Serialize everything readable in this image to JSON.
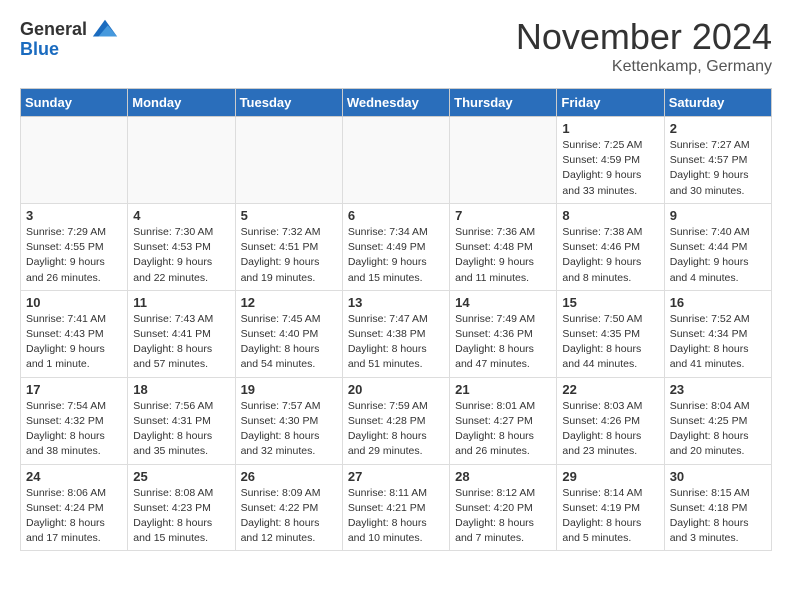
{
  "header": {
    "logo_general": "General",
    "logo_blue": "Blue",
    "month_title": "November 2024",
    "location": "Kettenkamp, Germany"
  },
  "days_of_week": [
    "Sunday",
    "Monday",
    "Tuesday",
    "Wednesday",
    "Thursday",
    "Friday",
    "Saturday"
  ],
  "weeks": [
    [
      {
        "day": "",
        "info": ""
      },
      {
        "day": "",
        "info": ""
      },
      {
        "day": "",
        "info": ""
      },
      {
        "day": "",
        "info": ""
      },
      {
        "day": "",
        "info": ""
      },
      {
        "day": "1",
        "info": "Sunrise: 7:25 AM\nSunset: 4:59 PM\nDaylight: 9 hours and 33 minutes."
      },
      {
        "day": "2",
        "info": "Sunrise: 7:27 AM\nSunset: 4:57 PM\nDaylight: 9 hours and 30 minutes."
      }
    ],
    [
      {
        "day": "3",
        "info": "Sunrise: 7:29 AM\nSunset: 4:55 PM\nDaylight: 9 hours and 26 minutes."
      },
      {
        "day": "4",
        "info": "Sunrise: 7:30 AM\nSunset: 4:53 PM\nDaylight: 9 hours and 22 minutes."
      },
      {
        "day": "5",
        "info": "Sunrise: 7:32 AM\nSunset: 4:51 PM\nDaylight: 9 hours and 19 minutes."
      },
      {
        "day": "6",
        "info": "Sunrise: 7:34 AM\nSunset: 4:49 PM\nDaylight: 9 hours and 15 minutes."
      },
      {
        "day": "7",
        "info": "Sunrise: 7:36 AM\nSunset: 4:48 PM\nDaylight: 9 hours and 11 minutes."
      },
      {
        "day": "8",
        "info": "Sunrise: 7:38 AM\nSunset: 4:46 PM\nDaylight: 9 hours and 8 minutes."
      },
      {
        "day": "9",
        "info": "Sunrise: 7:40 AM\nSunset: 4:44 PM\nDaylight: 9 hours and 4 minutes."
      }
    ],
    [
      {
        "day": "10",
        "info": "Sunrise: 7:41 AM\nSunset: 4:43 PM\nDaylight: 9 hours and 1 minute."
      },
      {
        "day": "11",
        "info": "Sunrise: 7:43 AM\nSunset: 4:41 PM\nDaylight: 8 hours and 57 minutes."
      },
      {
        "day": "12",
        "info": "Sunrise: 7:45 AM\nSunset: 4:40 PM\nDaylight: 8 hours and 54 minutes."
      },
      {
        "day": "13",
        "info": "Sunrise: 7:47 AM\nSunset: 4:38 PM\nDaylight: 8 hours and 51 minutes."
      },
      {
        "day": "14",
        "info": "Sunrise: 7:49 AM\nSunset: 4:36 PM\nDaylight: 8 hours and 47 minutes."
      },
      {
        "day": "15",
        "info": "Sunrise: 7:50 AM\nSunset: 4:35 PM\nDaylight: 8 hours and 44 minutes."
      },
      {
        "day": "16",
        "info": "Sunrise: 7:52 AM\nSunset: 4:34 PM\nDaylight: 8 hours and 41 minutes."
      }
    ],
    [
      {
        "day": "17",
        "info": "Sunrise: 7:54 AM\nSunset: 4:32 PM\nDaylight: 8 hours and 38 minutes."
      },
      {
        "day": "18",
        "info": "Sunrise: 7:56 AM\nSunset: 4:31 PM\nDaylight: 8 hours and 35 minutes."
      },
      {
        "day": "19",
        "info": "Sunrise: 7:57 AM\nSunset: 4:30 PM\nDaylight: 8 hours and 32 minutes."
      },
      {
        "day": "20",
        "info": "Sunrise: 7:59 AM\nSunset: 4:28 PM\nDaylight: 8 hours and 29 minutes."
      },
      {
        "day": "21",
        "info": "Sunrise: 8:01 AM\nSunset: 4:27 PM\nDaylight: 8 hours and 26 minutes."
      },
      {
        "day": "22",
        "info": "Sunrise: 8:03 AM\nSunset: 4:26 PM\nDaylight: 8 hours and 23 minutes."
      },
      {
        "day": "23",
        "info": "Sunrise: 8:04 AM\nSunset: 4:25 PM\nDaylight: 8 hours and 20 minutes."
      }
    ],
    [
      {
        "day": "24",
        "info": "Sunrise: 8:06 AM\nSunset: 4:24 PM\nDaylight: 8 hours and 17 minutes."
      },
      {
        "day": "25",
        "info": "Sunrise: 8:08 AM\nSunset: 4:23 PM\nDaylight: 8 hours and 15 minutes."
      },
      {
        "day": "26",
        "info": "Sunrise: 8:09 AM\nSunset: 4:22 PM\nDaylight: 8 hours and 12 minutes."
      },
      {
        "day": "27",
        "info": "Sunrise: 8:11 AM\nSunset: 4:21 PM\nDaylight: 8 hours and 10 minutes."
      },
      {
        "day": "28",
        "info": "Sunrise: 8:12 AM\nSunset: 4:20 PM\nDaylight: 8 hours and 7 minutes."
      },
      {
        "day": "29",
        "info": "Sunrise: 8:14 AM\nSunset: 4:19 PM\nDaylight: 8 hours and 5 minutes."
      },
      {
        "day": "30",
        "info": "Sunrise: 8:15 AM\nSunset: 4:18 PM\nDaylight: 8 hours and 3 minutes."
      }
    ]
  ]
}
